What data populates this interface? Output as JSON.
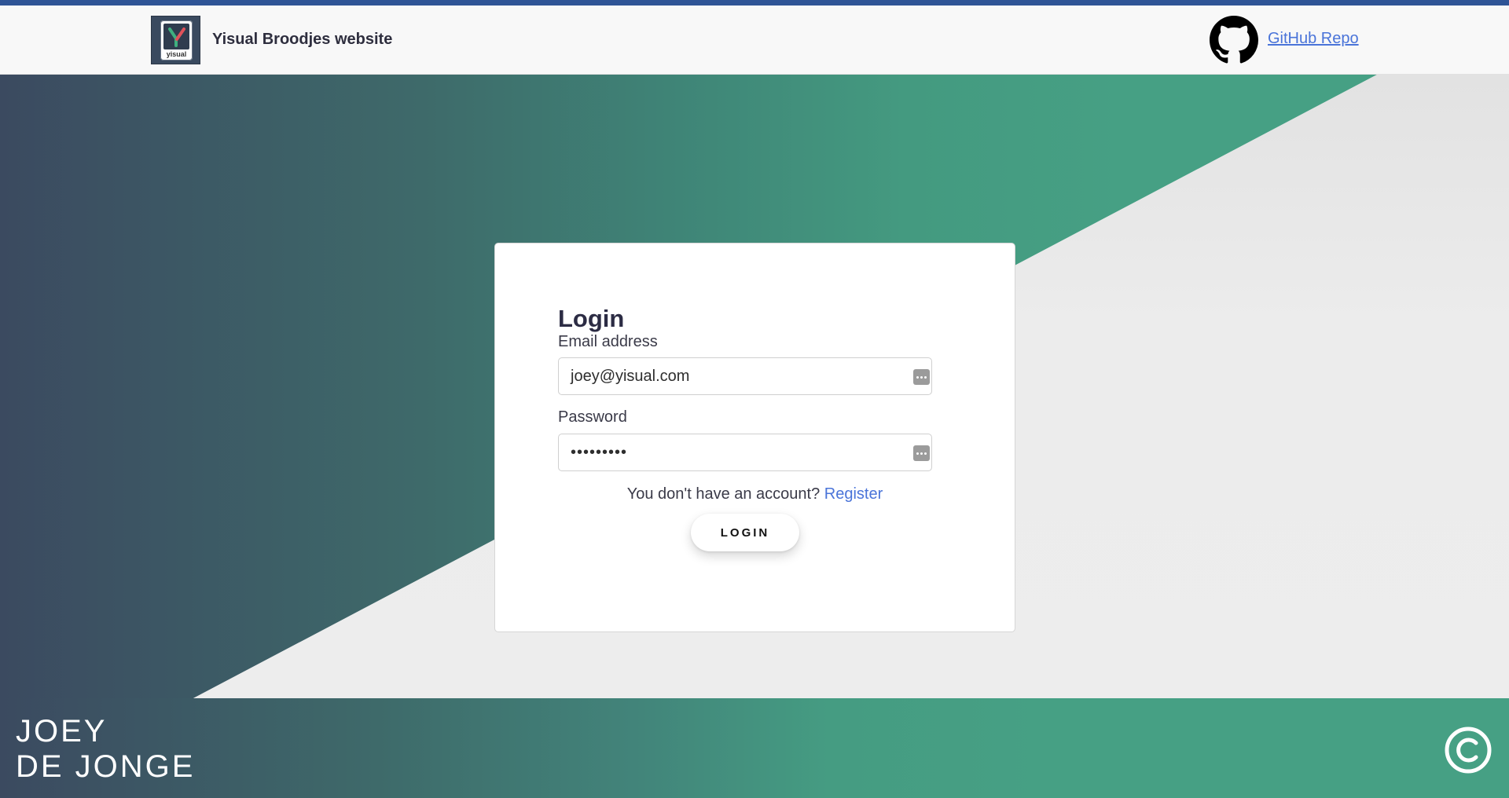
{
  "header": {
    "brand_title": "Yisual Broodjes website",
    "logo_text": "yisual",
    "github_label": "GitHub Repo"
  },
  "login": {
    "title": "Login",
    "email_label": "Email address",
    "email_value": "joey@yisual.com",
    "password_label": "Password",
    "password_value": "•••••••••",
    "register_prompt": "You don't have an account?",
    "register_link": "Register",
    "login_button": "LOGIN"
  },
  "footer": {
    "name_line1": "JOEY",
    "name_line2": "DE JONGE"
  },
  "colors": {
    "top_stripe": "#2f5496",
    "link": "#4a74d9",
    "gradient_start": "#3b4a60",
    "gradient_end": "#46a084"
  },
  "icons": {
    "github": "github-icon",
    "copyright": "copyright-icon",
    "password_manager": "password-manager-icon"
  }
}
